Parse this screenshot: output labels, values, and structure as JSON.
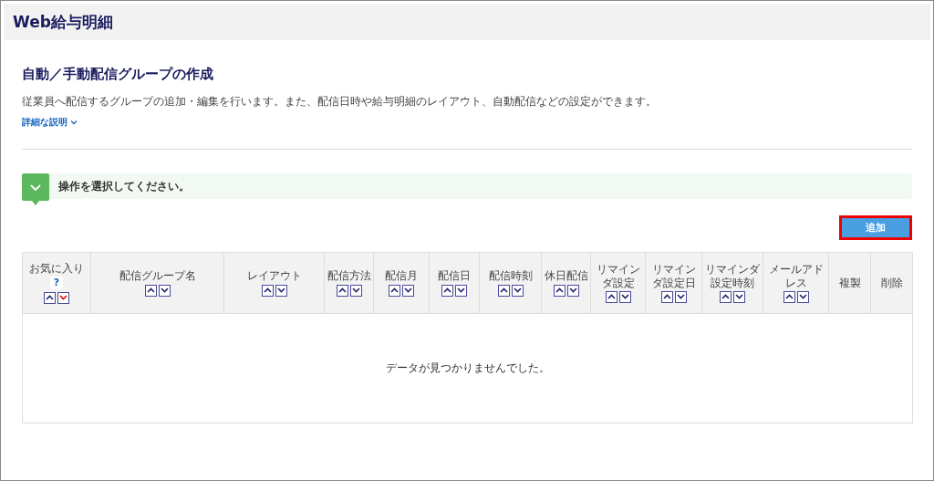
{
  "app_title": "Web給与明細",
  "page": {
    "title": "自動／手動配信グループの作成",
    "description": "従業員へ配信するグループの追加・編集を行います。また、配信日時や給与明細のレイアウト、自動配信などの設定ができます。",
    "details_link": {
      "label": "詳細な説明",
      "expanded": false
    }
  },
  "notice": {
    "message": "操作を選択してください。",
    "expanded": false
  },
  "add_button": {
    "label": "追加",
    "highlighted": true
  },
  "table": {
    "columns": [
      {
        "label": "お気に入り",
        "help": "?",
        "sortable": true,
        "sorted_descending": true
      },
      {
        "label": "配信グループ名",
        "sortable": true,
        "sorted_descending": false
      },
      {
        "label": "レイアウト",
        "sortable": true,
        "sorted_descending": false
      },
      {
        "label": "配信方法",
        "sortable": true,
        "sorted_descending": false
      },
      {
        "label": "配信月",
        "sortable": true,
        "sorted_descending": false
      },
      {
        "label": "配信日",
        "sortable": true,
        "sorted_descending": false
      },
      {
        "label": "配信時刻",
        "sortable": true,
        "sorted_descending": false
      },
      {
        "label": "休日配信",
        "sortable": true,
        "sorted_descending": false
      },
      {
        "label": "リマインダ設定",
        "sortable": true,
        "sorted_descending": false
      },
      {
        "label": "リマインダ設定日",
        "sortable": true,
        "sorted_descending": false
      },
      {
        "label": "リマインダ設定時刻",
        "sortable": true,
        "sorted_descending": false
      },
      {
        "label": "メールアドレス",
        "sortable": true,
        "sorted_descending": false
      },
      {
        "label": "複製",
        "sortable": false
      },
      {
        "label": "削除",
        "sortable": false
      }
    ],
    "empty_message": "データが見つかりませんでした。"
  }
}
